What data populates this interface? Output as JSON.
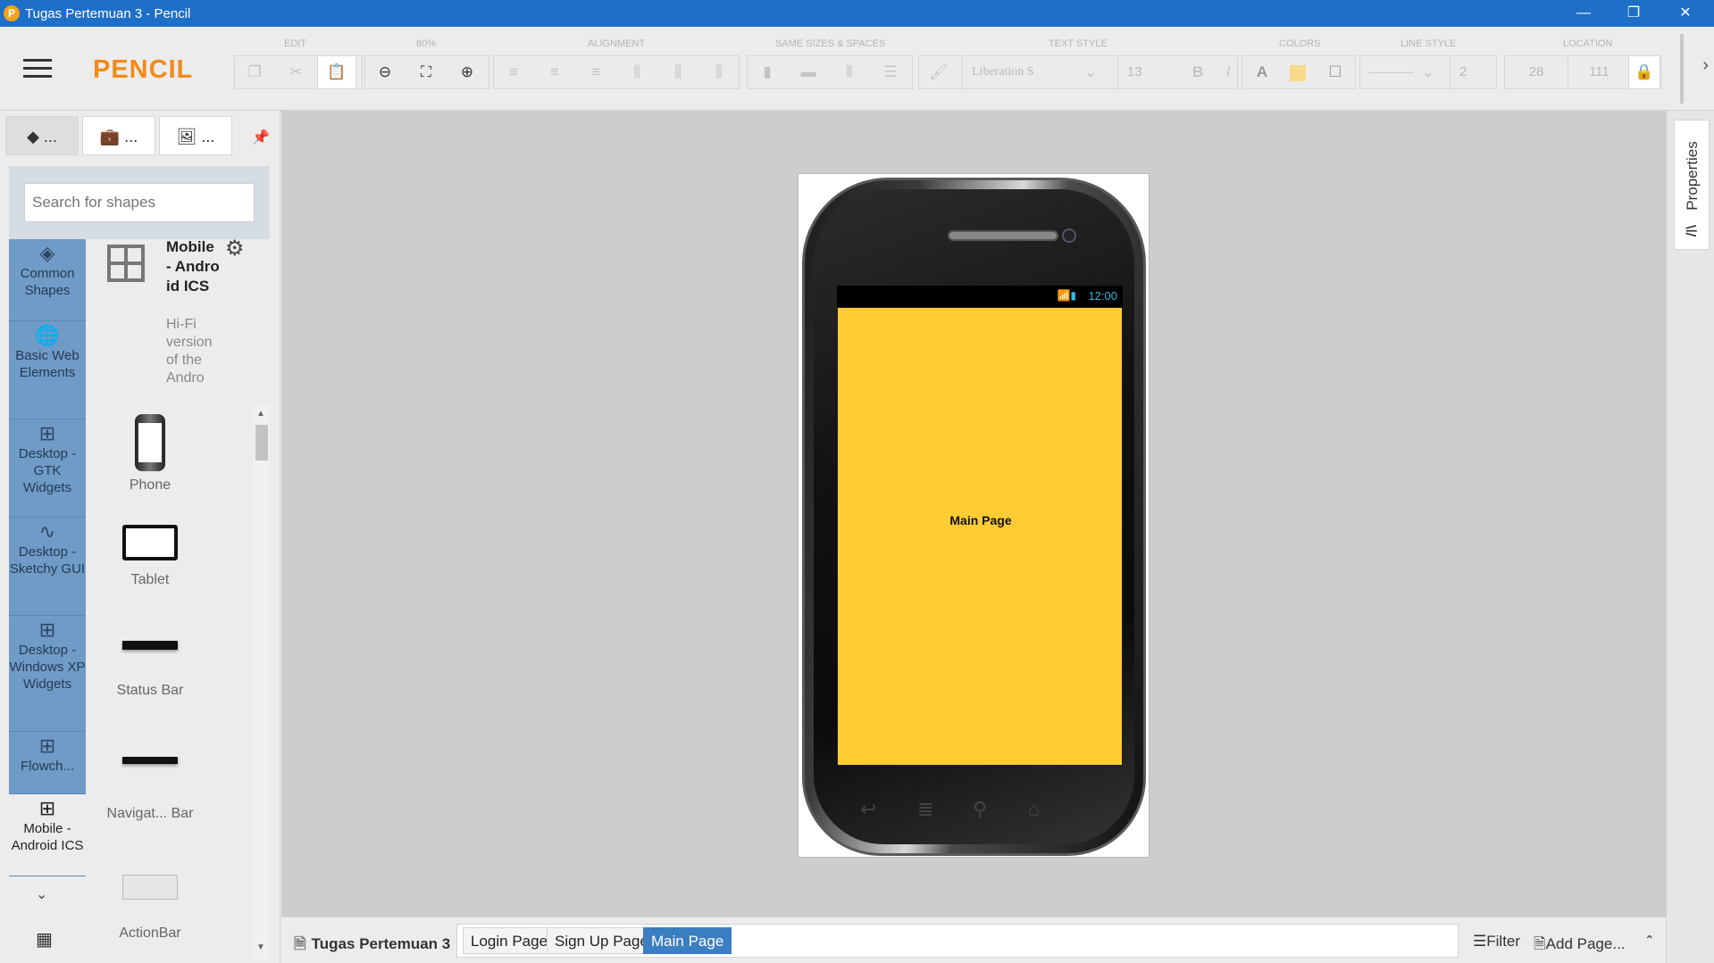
{
  "window": {
    "title": "Tugas Pertemuan 3 - Pencil",
    "app_icon": "P",
    "minimize": "—",
    "restore": "❐",
    "close": "✕"
  },
  "toolbar": {
    "brand": "PENCIL",
    "groups": {
      "edit": "EDIT",
      "zoom": "80%",
      "alignment": "ALIGNMENT",
      "same_sizes": "SAME SIZES & SPACES",
      "text_style": "TEXT STYLE",
      "colors": "COLORS",
      "line_style": "LINE STYLE",
      "location": "LOCATION"
    },
    "font_name": "Liberation S",
    "font_size": "13",
    "bold": "B",
    "italic": "I",
    "text_color": "A",
    "line_width": "2",
    "loc_x": "28",
    "loc_y": "111",
    "more": "›"
  },
  "left_panel": {
    "tabs": [
      "...",
      "...",
      "..."
    ],
    "search_placeholder": "Search for shapes",
    "categories": [
      {
        "label": "Common Shapes",
        "icon": "layers-icon"
      },
      {
        "label": "Basic Web Elements",
        "icon": "globe-icon"
      },
      {
        "label": "Desktop - GTK Widgets",
        "icon": "grid-icon"
      },
      {
        "label": "Desktop - Sketchy GUI",
        "icon": "squiggle-icon"
      },
      {
        "label": "Desktop - Windows XP Widgets",
        "icon": "grid-icon"
      },
      {
        "label": "Flowch...",
        "icon": "grid-icon"
      },
      {
        "label": "Mobile - Android ICS",
        "icon": "grid-icon"
      }
    ],
    "collection": {
      "name": "Mobile - Android ICS",
      "description": "Hi-Fi version of the Andro"
    },
    "shapes": [
      "Phone",
      "Tablet",
      "Status Bar",
      "Navigat... Bar",
      "ActionBar"
    ]
  },
  "canvas": {
    "screen_label": "Main Page",
    "status_time": "12:00",
    "screen_color": "#ffcc33"
  },
  "right_panel": {
    "properties_label": "Properties"
  },
  "bottom": {
    "document_name": "Tugas Pertemuan 3",
    "pages": [
      "Login Page",
      "Sign Up Page",
      "Main Page"
    ],
    "active_page": "Main Page",
    "filter": "Filter",
    "add_page": "Add Page..."
  },
  "colors": {
    "titlebar": "#1e6fc7",
    "brand": "#f28a1a",
    "category_bg": "#6f9bc6",
    "active_tab": "#3b7ec2"
  }
}
